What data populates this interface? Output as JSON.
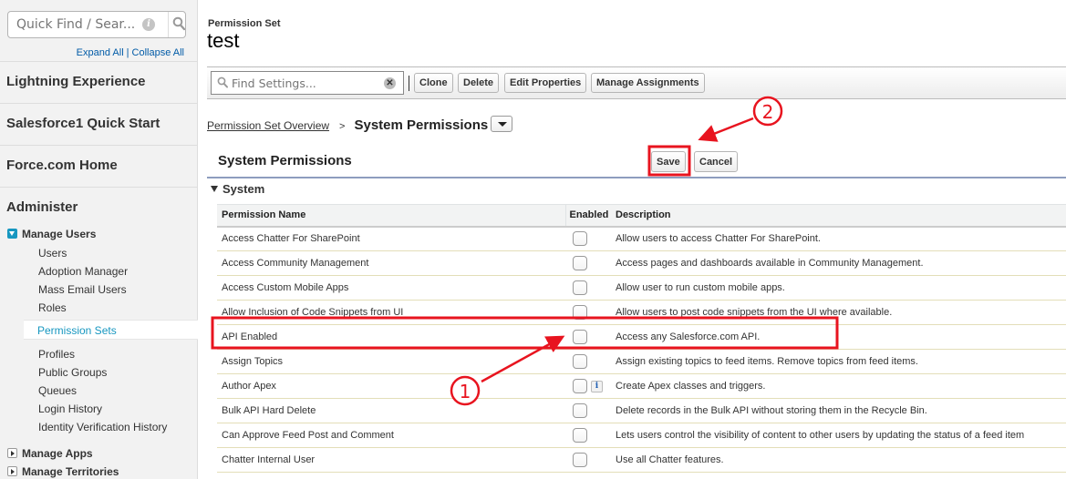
{
  "sidebar": {
    "quick_find_placeholder": "Quick Find / Sear...",
    "expand_all": "Expand All",
    "separator": "|",
    "collapse_all": "Collapse All",
    "sections": [
      {
        "label": "Lightning Experience"
      },
      {
        "label": "Salesforce1 Quick Start"
      },
      {
        "label": "Force.com Home"
      },
      {
        "label": "Administer"
      }
    ],
    "manage_users": {
      "label": "Manage Users",
      "expanded": true,
      "items": [
        "Users",
        "Adoption Manager",
        "Mass Email Users",
        "Roles",
        "Permission Sets",
        "Profiles",
        "Public Groups",
        "Queues",
        "Login History",
        "Identity Verification History"
      ],
      "active_item": "Permission Sets"
    },
    "collapsed_groups": [
      {
        "label": "Manage Apps"
      },
      {
        "label": "Manage Territories"
      }
    ]
  },
  "header": {
    "object_label": "Permission Set",
    "record_title": "test"
  },
  "toolbar": {
    "find_settings_placeholder": "Find Settings...",
    "clone": "Clone",
    "delete": "Delete",
    "edit_properties": "Edit Properties",
    "manage_assignments": "Manage Assignments"
  },
  "breadcrumb": {
    "parent": "Permission Set Overview",
    "separator": ">",
    "current": "System Permissions"
  },
  "section": {
    "title": "System Permissions",
    "save": "Save",
    "cancel": "Cancel",
    "group_label": "System"
  },
  "table": {
    "columns": [
      "Permission Name",
      "Enabled",
      "Description"
    ],
    "rows": [
      {
        "name": "Access Chatter For SharePoint",
        "enabled": false,
        "info": false,
        "description": "Allow users to access Chatter For SharePoint."
      },
      {
        "name": "Access Community Management",
        "enabled": false,
        "info": false,
        "description": "Access pages and dashboards available in Community Management."
      },
      {
        "name": "Access Custom Mobile Apps",
        "enabled": false,
        "info": false,
        "description": "Allow user to run custom mobile apps."
      },
      {
        "name": "Allow Inclusion of Code Snippets from UI",
        "enabled": false,
        "info": false,
        "description": "Allow users to post code snippets from the UI where available."
      },
      {
        "name": "API Enabled",
        "enabled": false,
        "info": false,
        "description": "Access any Salesforce.com API."
      },
      {
        "name": "Assign Topics",
        "enabled": false,
        "info": false,
        "description": "Assign existing topics to feed items. Remove topics from feed items."
      },
      {
        "name": "Author Apex",
        "enabled": false,
        "info": true,
        "description": "Create Apex classes and triggers."
      },
      {
        "name": "Bulk API Hard Delete",
        "enabled": false,
        "info": false,
        "description": "Delete records in the Bulk API without storing them in the Recycle Bin."
      },
      {
        "name": "Can Approve Feed Post and Comment",
        "enabled": false,
        "info": false,
        "description": "Lets users control the visibility of content to other users by updating the status of a feed item"
      },
      {
        "name": "Chatter Internal User",
        "enabled": false,
        "info": false,
        "description": "Use all Chatter features."
      }
    ]
  },
  "annotations": {
    "step1": "1",
    "step2": "2",
    "color": "#e8141f"
  }
}
